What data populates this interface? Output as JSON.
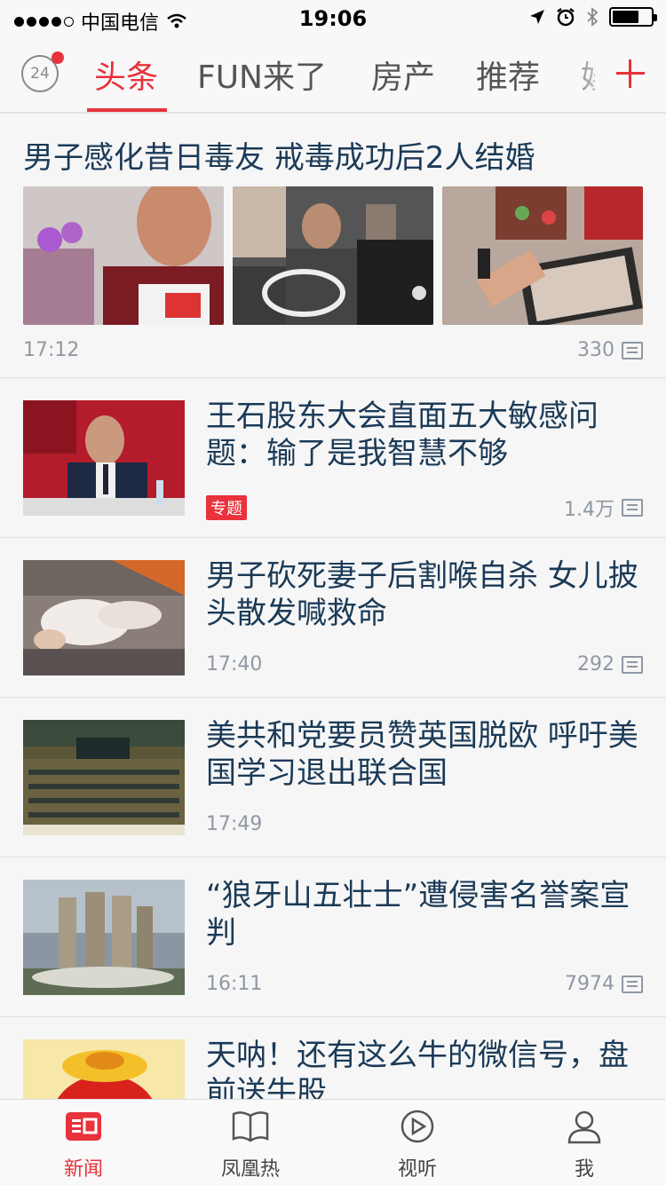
{
  "status_bar": {
    "carrier": "中国电信",
    "time": "19:06",
    "battery_level": 0.7
  },
  "tabs": {
    "clock_label": "24",
    "items": [
      {
        "label": "头条",
        "active": true
      },
      {
        "label": "FUN来了",
        "active": false
      },
      {
        "label": "房产",
        "active": false
      },
      {
        "label": "推荐",
        "active": false
      },
      {
        "label": "娱",
        "active": false
      }
    ]
  },
  "feed": {
    "lead": {
      "title": "男子感化昔日毒友 戒毒成功后2人结婚",
      "time": "17:12",
      "comments": "330"
    },
    "items": [
      {
        "title": "王石股东大会直面五大敏感问题：输了是我智慧不够",
        "tag": "专题",
        "time": "",
        "comments": "1.4万"
      },
      {
        "title": "男子砍死妻子后割喉自杀 女儿披头散发喊救命",
        "tag": "",
        "time": "17:40",
        "comments": "292"
      },
      {
        "title": "美共和党要员赞英国脱欧 呼吁美国学习退出联合国",
        "tag": "",
        "time": "17:49",
        "comments": ""
      },
      {
        "title": "“狼牙山五壮士”遭侵害名誉案宣判",
        "tag": "",
        "time": "16:11",
        "comments": "7974"
      },
      {
        "title": "天呐！还有这么牛的微信号，盘前送牛股",
        "tag": "",
        "time": "",
        "comments": ""
      }
    ]
  },
  "bottom_nav": {
    "items": [
      {
        "label": "新闻",
        "icon": "news-icon",
        "active": true
      },
      {
        "label": "凤凰热",
        "icon": "book-icon",
        "active": false
      },
      {
        "label": "视听",
        "icon": "play-icon",
        "active": false
      },
      {
        "label": "我",
        "icon": "user-icon",
        "active": false
      }
    ]
  },
  "colors": {
    "accent": "#e8323c",
    "title": "#1b3a57",
    "meta": "#8f98a3"
  }
}
